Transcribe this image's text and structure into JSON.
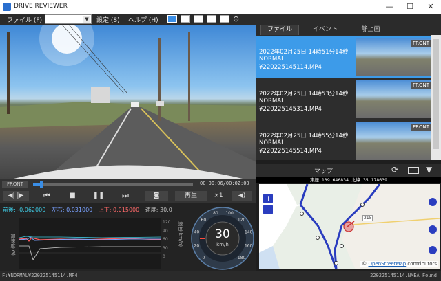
{
  "app": {
    "title": "DRIVE REVIEWER"
  },
  "window_controls": {
    "minimize": "—",
    "maximize": "☐",
    "close": "✕"
  },
  "menu": {
    "file": "ファイル (F)",
    "settings": "設定 (S)",
    "help": "ヘルプ (H)"
  },
  "video": {
    "camera_tag": "FRONT",
    "time": "00:00:06/00:02:00",
    "progress": 0.05,
    "play_label": "再生",
    "speed_label": "×1"
  },
  "sensor": {
    "forward_label": "前後: -0.062000",
    "lateral_label": "左右: 0.031000",
    "vertical_label": "上下: 0.015000",
    "speed_label": "速度: 30.0",
    "left_axis": "加速度(G)",
    "right_axis": "速度(km/h)",
    "right_ticks": [
      "120",
      "90",
      "60",
      "30",
      "0"
    ],
    "speed_value": "30",
    "speed_unit": "km/h",
    "gauge_ticks": [
      "0",
      "20",
      "40",
      "60",
      "80",
      "100",
      "120",
      "140",
      "160",
      "180"
    ]
  },
  "tabs": [
    {
      "label": "ファイル",
      "active": true
    },
    {
      "label": "イベント",
      "active": false
    },
    {
      "label": "静止画",
      "active": false
    }
  ],
  "files": [
    {
      "datetime": "2022年02月25日 14時51分14秒",
      "type": "NORMAL",
      "path": "¥220225145114.MP4",
      "tag": "FRONT",
      "selected": true
    },
    {
      "datetime": "2022年02月25日 14時53分14秒",
      "type": "NORMAL",
      "path": "¥220225145314.MP4",
      "tag": "FRONT",
      "selected": false
    },
    {
      "datetime": "2022年02月25日 14時55分14秒",
      "type": "NORMAL",
      "path": "¥220225145514.MP4",
      "tag": "FRONT",
      "selected": false
    }
  ],
  "map": {
    "title": "マップ",
    "coords": "東経 139.646834  北緯 35.178639",
    "road_label": "215",
    "attribution_prefix": "© ",
    "attribution_link": "OpenStreetMap",
    "attribution_suffix": " contributors"
  },
  "status": {
    "left": "F:¥NORMAL¥220225145114.MP4",
    "right": "220225145114.NMEA Found"
  }
}
